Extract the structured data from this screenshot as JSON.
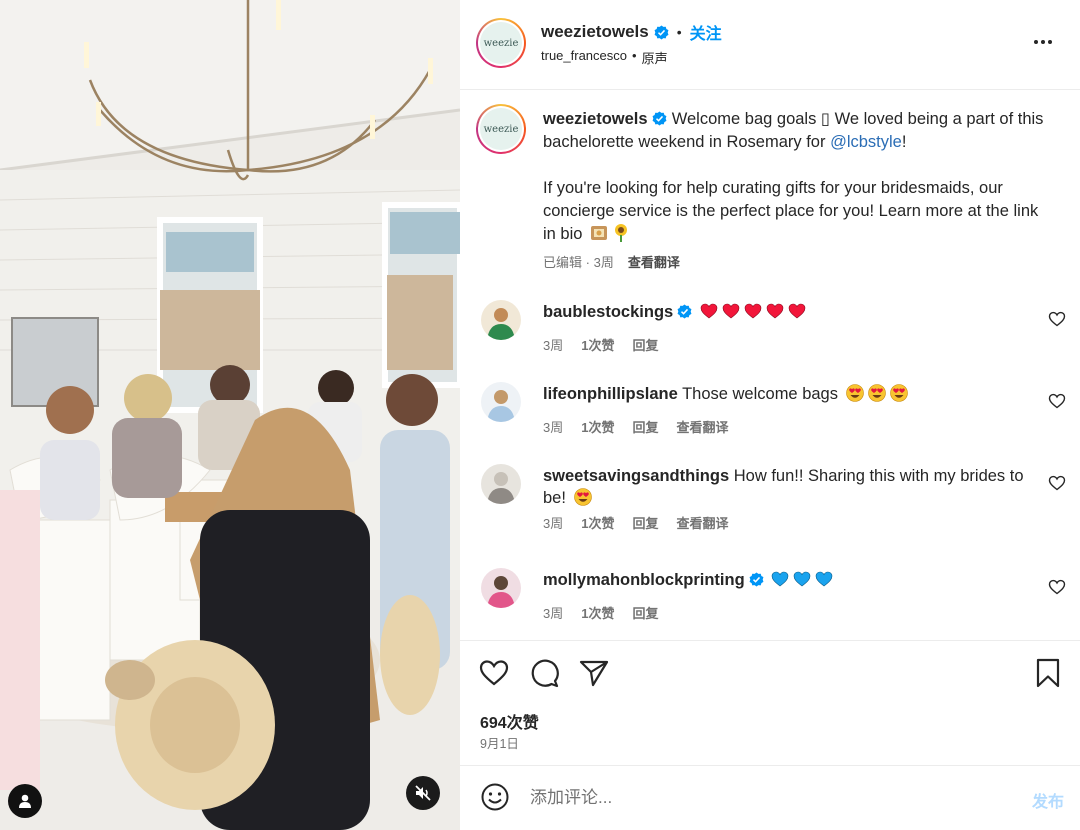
{
  "post": {
    "author": "weezietowels",
    "avatar_text": "weezie",
    "follow_label": "关注",
    "audio_user": "true_francesco",
    "audio_label": "原声"
  },
  "caption": {
    "username": "weezietowels",
    "text_part1": " Welcome bag goals ",
    "box_glyph": "▯",
    "text_part2": " We loved being a part of this bachelorette weekend in Rosemary for ",
    "mention": "@lcbstyle",
    "text_part3": "!",
    "para2": "If you're looking for help curating gifts for your bridesmaids, our concierge service is the perfect place for you! Learn more at the link in bio",
    "edited": "已编辑",
    "sep": "·",
    "time": "3周",
    "translate": "查看翻译"
  },
  "comments": [
    {
      "username": "baublestockings",
      "text": "",
      "emoji": [
        "red-heart",
        "red-heart",
        "red-heart",
        "red-heart",
        "red-heart"
      ],
      "time": "3周",
      "likes": "1次赞",
      "reply": "回复",
      "translate": ""
    },
    {
      "username": "lifeonphillipslane",
      "text": "Those welcome bags",
      "emoji": [
        "heart-eyes",
        "heart-eyes",
        "heart-eyes"
      ],
      "time": "3周",
      "likes": "1次赞",
      "reply": "回复",
      "translate": "查看翻译"
    },
    {
      "username": "sweetsavingsandthings",
      "text": "How fun!! Sharing this with my brides to be!",
      "emoji": [
        "heart-eyes"
      ],
      "time": "3周",
      "likes": "1次赞",
      "reply": "回复",
      "translate": "查看翻译"
    },
    {
      "username": "mollymahonblockprinting",
      "text": "",
      "emoji": [
        "blue-heart",
        "blue-heart",
        "blue-heart"
      ],
      "time": "3周",
      "likes": "1次赞",
      "reply": "回复",
      "translate": ""
    }
  ],
  "stats": {
    "likes": "694次赞",
    "date": "9月1日"
  },
  "comment_box": {
    "placeholder": "添加评论...",
    "post_label": "发布"
  },
  "colors": {
    "accent": "#0095f6",
    "verified": "#0095f6",
    "muted": "#737373",
    "post_disabled": "#b3dbff"
  },
  "icons": [
    "user-tag-icon",
    "mute-icon",
    "more-icon",
    "like-icon",
    "comment-icon",
    "share-icon",
    "save-icon",
    "emoji-icon",
    "heart-icon",
    "verified-icon"
  ]
}
